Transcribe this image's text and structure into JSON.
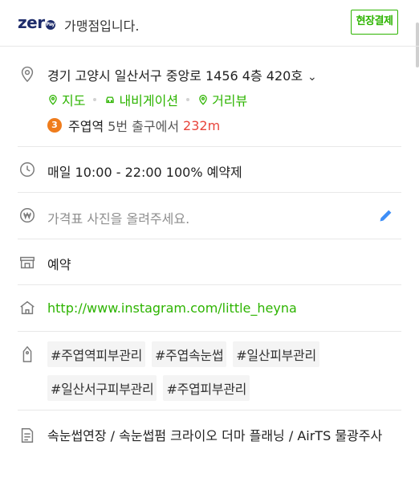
{
  "header": {
    "logo_text": "zer",
    "logo_pay": "Pay",
    "merchant_text": "가맹점입니다.",
    "onsite_badge": "현장결제"
  },
  "address": {
    "full": "경기 고양시 일산서구 중앙로 1456 4층 420호",
    "expand_icon": "chevron-down-icon",
    "links": [
      {
        "label": "지도",
        "icon": "pin-outline-icon"
      },
      {
        "label": "내비게이션",
        "icon": "car-icon"
      },
      {
        "label": "거리뷰",
        "icon": "pin-outline-icon"
      }
    ],
    "subway": {
      "line": "3",
      "line_color": "#ef7c1c",
      "station": "주엽역",
      "exit_text": "5번 출구에서",
      "distance": "232m"
    }
  },
  "hours": {
    "text": "매일 10:00 - 22:00 100% 예약제"
  },
  "price": {
    "placeholder": "가격표 사진을 올려주세요.",
    "edit_icon": "pencil-icon"
  },
  "booking": {
    "label": "예약"
  },
  "homepage": {
    "url": "http://www.instagram.com/little_heyna"
  },
  "keywords": {
    "tags": [
      "#주엽역피부관리",
      "#주엽속눈썹",
      "#일산피부관리",
      "#일산서구피부관리",
      "#주엽피부관리"
    ]
  },
  "description": {
    "text": "속눈썹연장 / 속눈썹펌 크라이오 더마 플래닝 / AirTS 물광주사"
  },
  "colors": {
    "accent_green": "#2db400",
    "distance_red": "#e8453c",
    "logo_navy": "#1e2c6b"
  }
}
